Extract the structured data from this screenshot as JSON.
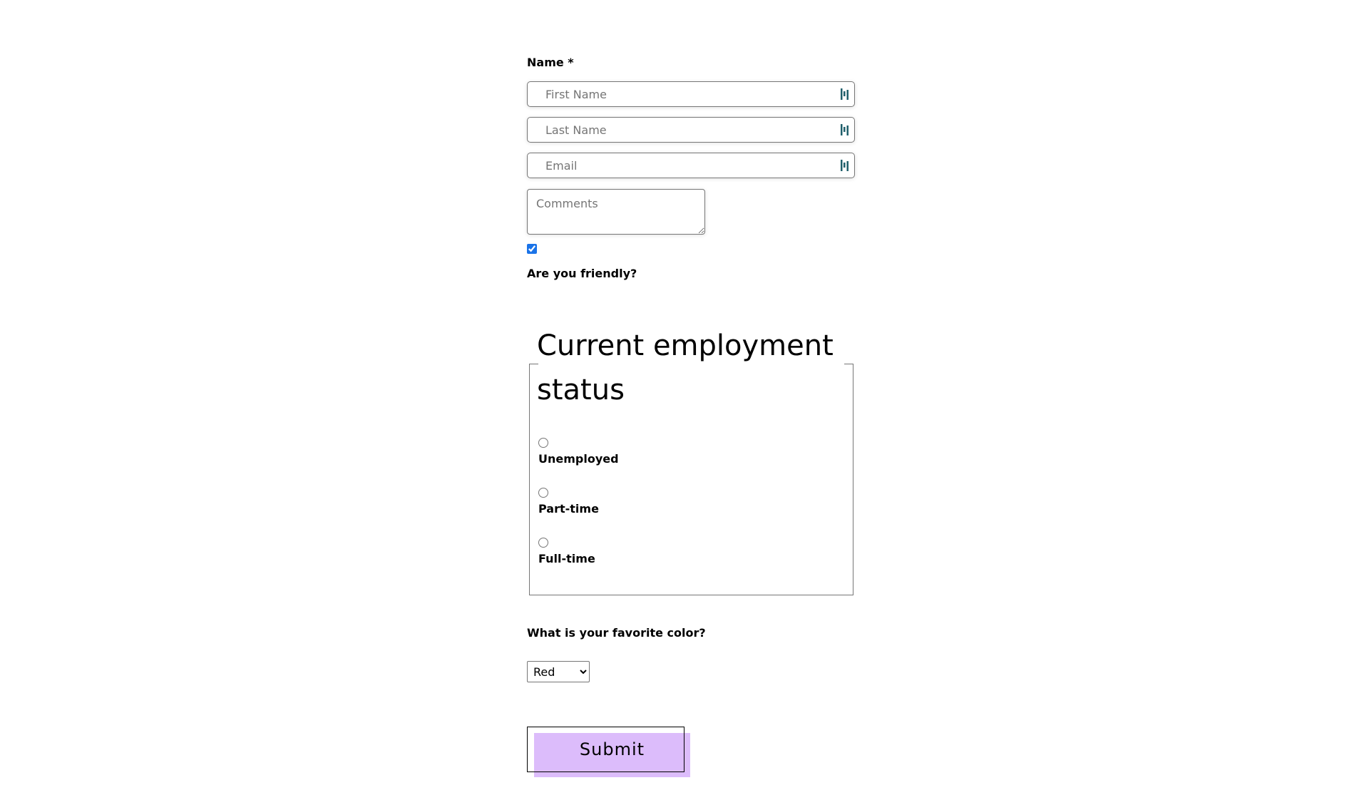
{
  "form": {
    "name_label": "Name *",
    "first_name": {
      "placeholder": "First Name",
      "value": ""
    },
    "last_name": {
      "placeholder": "Last Name",
      "value": ""
    },
    "email": {
      "placeholder": "Email",
      "value": ""
    },
    "comments": {
      "placeholder": "Comments",
      "value": ""
    },
    "friendly": {
      "label": "Are you friendly?",
      "checked": true
    },
    "employment": {
      "legend": "Current employment status",
      "options": [
        {
          "label": "Unemployed",
          "selected": false
        },
        {
          "label": "Part-time",
          "selected": false
        },
        {
          "label": "Full-time",
          "selected": false
        }
      ]
    },
    "color": {
      "label": "What is your favorite color?",
      "selected": "Red"
    },
    "submit_label": "Submit"
  },
  "colors": {
    "submit_highlight": "#dcbcfb",
    "password_manager_icon": "#1f5f6b",
    "checkbox_accent": "#1a73e8"
  },
  "icons": {
    "field_icon": "password-manager-icon"
  }
}
